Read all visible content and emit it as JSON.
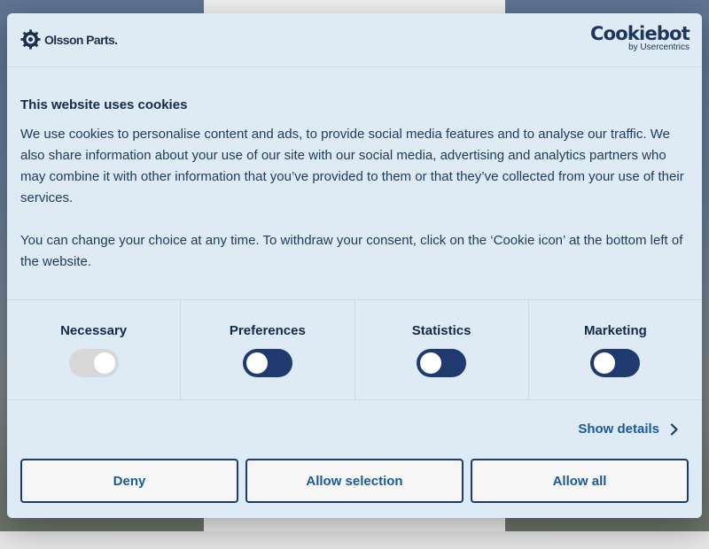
{
  "brand": {
    "name": "Olsson Parts."
  },
  "provider": {
    "name": "Cookiebot",
    "byline": "by Usercentrics"
  },
  "content": {
    "title": "This website uses cookies",
    "paragraph1": "We use cookies to personalise content and ads, to provide social media features and to analyse our traffic. We also share information about your use of our site with our social media, advertising and analytics partners who may combine it with other information that you’ve provided to them or that they’ve collected from your use of their services.",
    "paragraph2": "You can change your choice at any time. To withdraw your consent, click on the ‘Cookie icon’ at the bottom left of the website."
  },
  "toggles": [
    {
      "label": "Necessary",
      "state": "on",
      "disabled": true
    },
    {
      "label": "Preferences",
      "state": "off",
      "disabled": false
    },
    {
      "label": "Statistics",
      "state": "off",
      "disabled": false
    },
    {
      "label": "Marketing",
      "state": "off",
      "disabled": false
    }
  ],
  "details_link": "Show details",
  "buttons": {
    "deny": "Deny",
    "allow_selection": "Allow selection",
    "allow_all": "Allow all"
  },
  "colors": {
    "dialog_bg": "#deeaf4",
    "primary": "#1e3a6e",
    "link": "#1a5a9c"
  }
}
